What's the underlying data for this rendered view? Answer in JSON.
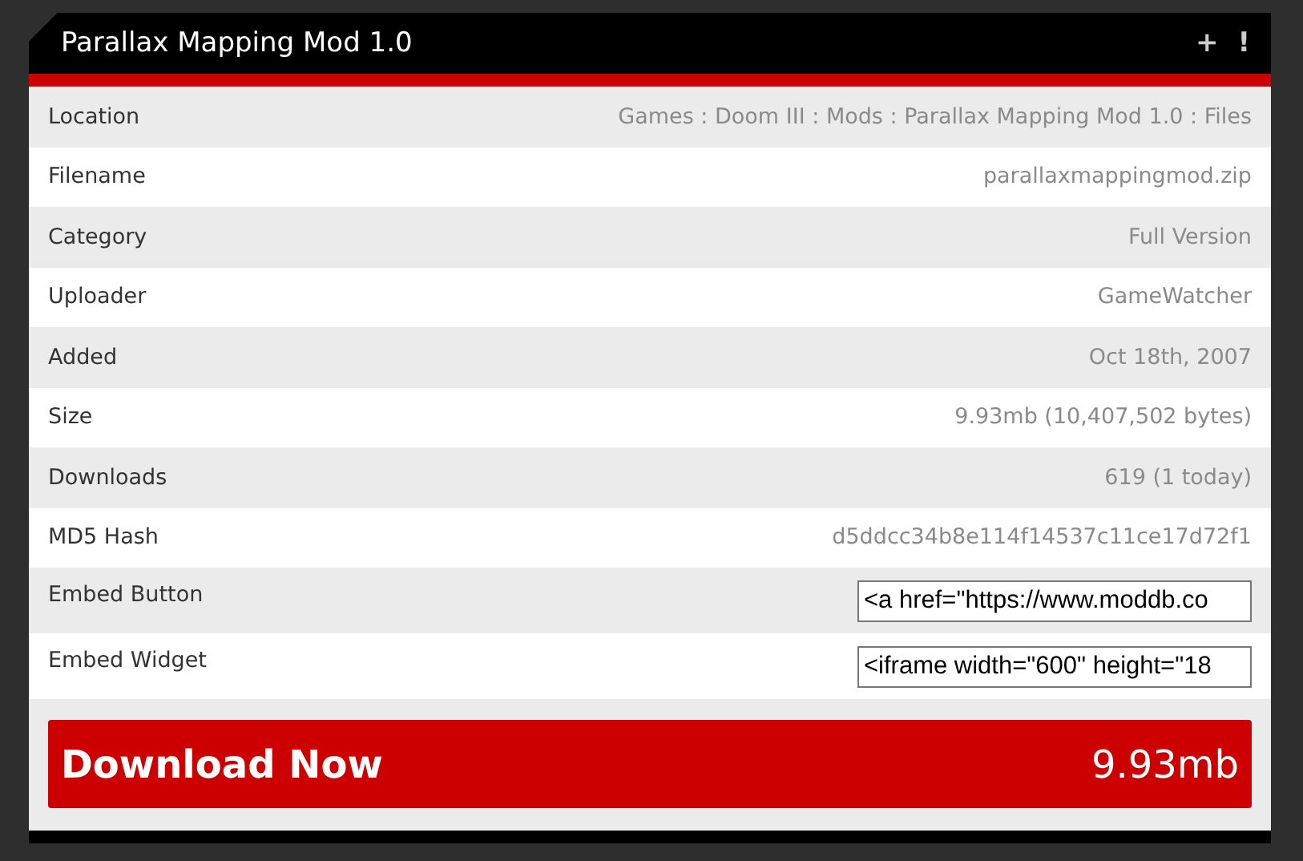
{
  "window": {
    "title": "Parallax Mapping Mod 1.0",
    "actions": [
      "+",
      "!"
    ]
  },
  "rows": [
    {
      "kind": "text",
      "label": "Location",
      "value": "Games : Doom III : Mods : Parallax Mapping Mod 1.0 : Files"
    },
    {
      "kind": "text",
      "label": "Filename",
      "value": "parallaxmappingmod.zip"
    },
    {
      "kind": "text",
      "label": "Category",
      "value": "Full Version"
    },
    {
      "kind": "text",
      "label": "Uploader",
      "value": "GameWatcher"
    },
    {
      "kind": "text",
      "label": "Added",
      "value": "Oct 18th, 2007"
    },
    {
      "kind": "text",
      "label": "Size",
      "value": "9.93mb (10,407,502 bytes)"
    },
    {
      "kind": "text",
      "label": "Downloads",
      "value": "619 (1 today)"
    },
    {
      "kind": "text",
      "label": "MD5 Hash",
      "value": "d5ddcc34b8e114f14537c11ce17d72f1"
    },
    {
      "kind": "field",
      "label": "Embed Button",
      "value": "<a href=\"https://www.moddb.co"
    },
    {
      "kind": "field",
      "label": "Embed Widget",
      "value": "<iframe width=\"600\" height=\"18"
    }
  ],
  "download": {
    "label": "Download Now",
    "size": "9.93mb"
  }
}
